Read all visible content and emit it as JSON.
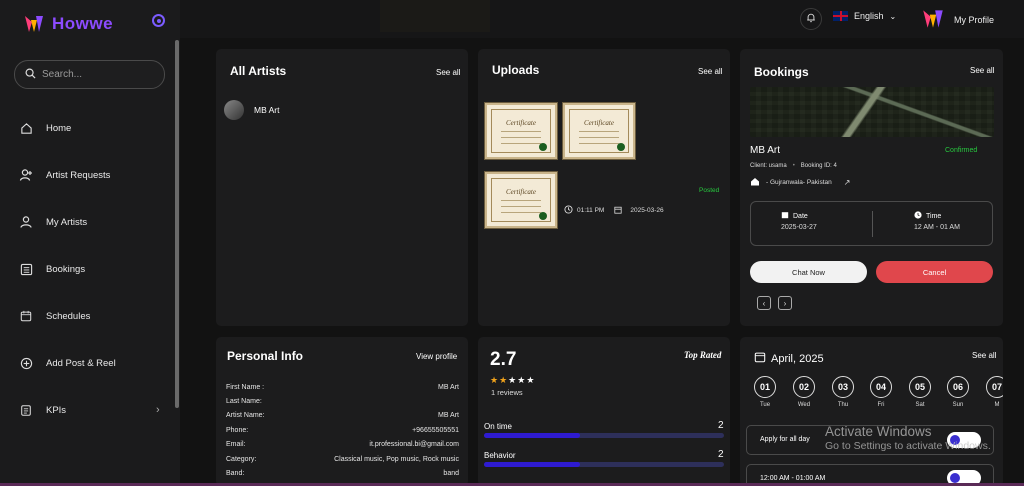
{
  "app": {
    "name": "Howwe"
  },
  "search": {
    "placeholder": "Search..."
  },
  "sidebar": {
    "items": [
      {
        "label": "Home",
        "icon": "home-icon"
      },
      {
        "label": "Artist Requests",
        "icon": "user-plus-icon"
      },
      {
        "label": "My Artists",
        "icon": "user-icon"
      },
      {
        "label": "Bookings",
        "icon": "list-icon"
      },
      {
        "label": "Schedules",
        "icon": "calendar-icon"
      },
      {
        "label": "Add Post & Reel",
        "icon": "plus-circle-icon"
      },
      {
        "label": "KPIs",
        "icon": "document-icon"
      }
    ]
  },
  "topbar": {
    "language": "English",
    "profile_label": "My Profile"
  },
  "artists": {
    "title": "All Artists",
    "see_all": "See all",
    "items": [
      {
        "name": "MB Art"
      }
    ]
  },
  "uploads": {
    "title": "Uploads",
    "see_all": "See all",
    "status": "Posted",
    "time": "01:11 PM",
    "date": "2025-03-26",
    "cert_label": "Certificate"
  },
  "bookings": {
    "title": "Bookings",
    "see_all": "See all",
    "artist": "MB Art",
    "status": "Confirmed",
    "client": "Client: usama",
    "booking_id": "Booking ID: 4",
    "location": "- Gujranwala- Pakistan",
    "date_label": "Date",
    "date_value": "2025-03-27",
    "time_label": "Time",
    "time_value": "12 AM - 01 AM",
    "chat_button": "Chat Now",
    "cancel_button": "Cancel"
  },
  "personal_info": {
    "title": "Personal Info",
    "view_profile": "View profile",
    "rows": [
      {
        "label": "First Name :",
        "value": "MB Art"
      },
      {
        "label": "Last Name:",
        "value": ""
      },
      {
        "label": "Artist Name:",
        "value": "MB Art"
      },
      {
        "label": "Phone:",
        "value": "+96655505551"
      },
      {
        "label": "Email:",
        "value": "it.professional.bi@gmail.com"
      },
      {
        "label": "Category:",
        "value": "Classical music, Pop music, Rock music"
      },
      {
        "label": "Band:",
        "value": "band"
      }
    ]
  },
  "rating": {
    "score": "2.7",
    "badge": "Top Rated",
    "reviews": "1 reviews",
    "stars_filled": 2,
    "stars_total": 5,
    "metrics": [
      {
        "label": "On time",
        "value": "2",
        "fraction": 0.4
      },
      {
        "label": "Behavior",
        "value": "2",
        "fraction": 0.4
      }
    ]
  },
  "calendar": {
    "month": "April, 2025",
    "see_all": "See all",
    "days": [
      {
        "num": "01",
        "name": "Tue"
      },
      {
        "num": "02",
        "name": "Wed"
      },
      {
        "num": "03",
        "name": "Thu"
      },
      {
        "num": "04",
        "name": "Fri"
      },
      {
        "num": "05",
        "name": "Sat"
      },
      {
        "num": "06",
        "name": "Sun"
      },
      {
        "num": "07",
        "name": "M"
      }
    ],
    "apply_all": "Apply for all day",
    "slot": "12:00 AM - 01:00 AM"
  },
  "watermark": {
    "line1": "Activate Windows",
    "line2": "Go to Settings to activate Windows."
  },
  "colors": {
    "accent": "#8c4bff",
    "danger": "#e0474c",
    "success": "#27c93f",
    "bar": "#2e1bd1"
  }
}
